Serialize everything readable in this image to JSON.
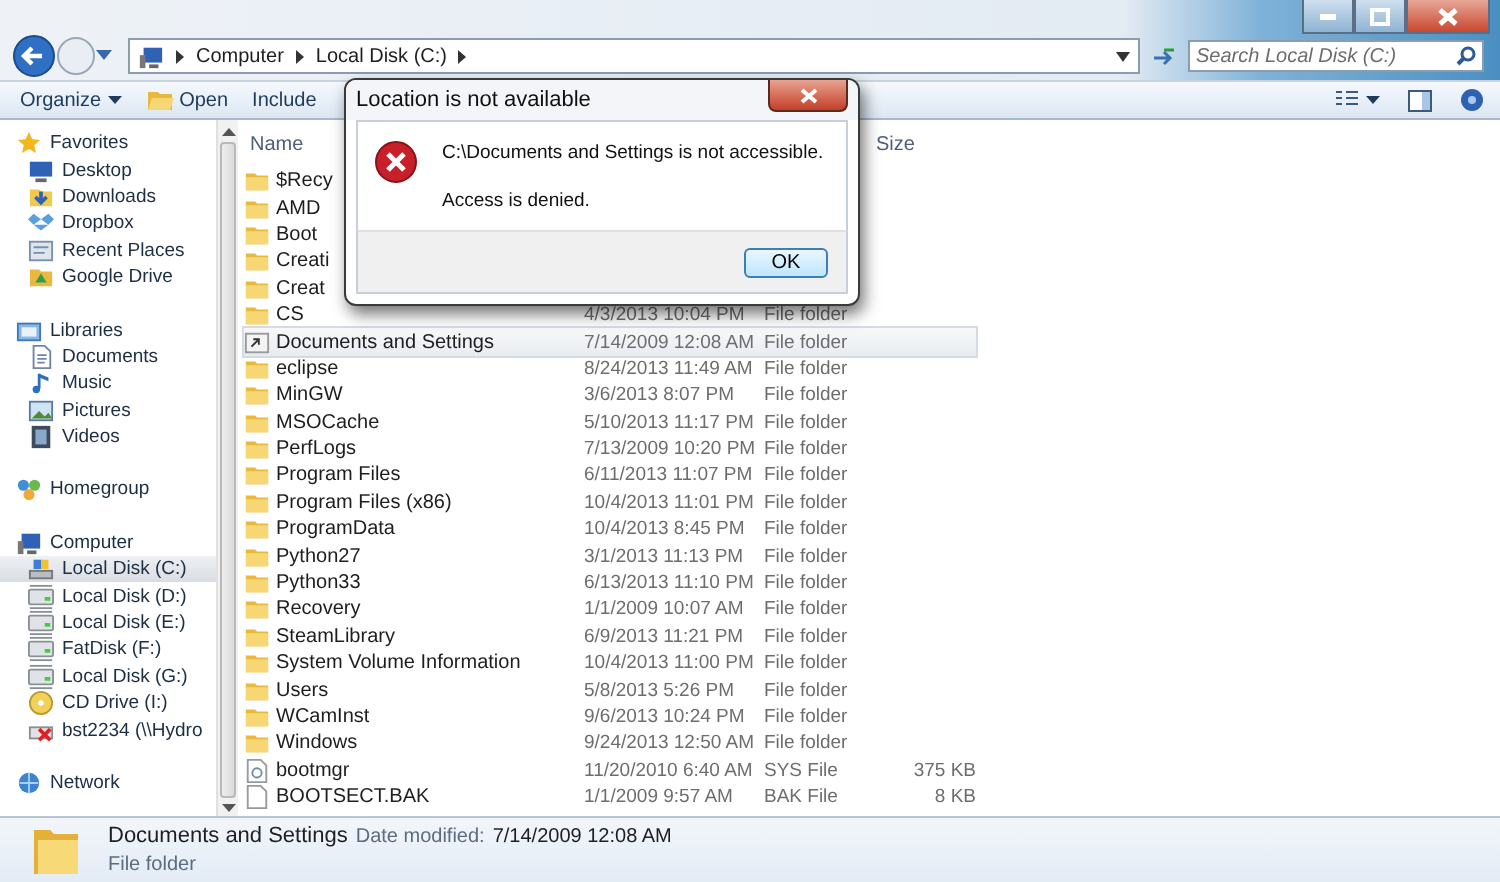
{
  "address": {
    "crumbs": [
      "Computer",
      "Local Disk (C:)"
    ]
  },
  "search": {
    "placeholder": "Search Local Disk (C:)"
  },
  "toolbar": {
    "items": [
      {
        "label": "Organize",
        "kind": "menu"
      },
      {
        "label": "Open",
        "kind": "open"
      },
      {
        "label": "Include",
        "kind": "plain"
      }
    ]
  },
  "nav": [
    {
      "label": "Favorites",
      "kind": "star",
      "selected": false,
      "children": [
        {
          "label": "Desktop",
          "kind": "desktop",
          "selected": false
        },
        {
          "label": "Downloads",
          "kind": "download",
          "selected": false
        },
        {
          "label": "Dropbox",
          "kind": "dropbox",
          "selected": false
        },
        {
          "label": "Recent Places",
          "kind": "recent",
          "selected": false
        },
        {
          "label": "Google Drive",
          "kind": "gdrive",
          "selected": false
        }
      ]
    },
    {
      "label": "Libraries",
      "kind": "library",
      "selected": false,
      "children": [
        {
          "label": "Documents",
          "kind": "document",
          "selected": false
        },
        {
          "label": "Music",
          "kind": "music",
          "selected": false
        },
        {
          "label": "Pictures",
          "kind": "picture",
          "selected": false
        },
        {
          "label": "Videos",
          "kind": "video",
          "selected": false
        }
      ]
    },
    {
      "label": "Homegroup",
      "kind": "homegroup",
      "selected": false
    },
    {
      "label": "Computer",
      "kind": "computer",
      "selected": false,
      "children": [
        {
          "label": "Local Disk (C:)",
          "kind": "sysdisk",
          "selected": true
        },
        {
          "label": "Local Disk (D:)",
          "kind": "disk",
          "selected": false
        },
        {
          "label": "Local Disk (E:)",
          "kind": "disk",
          "selected": false
        },
        {
          "label": "FatDisk (F:)",
          "kind": "disk",
          "selected": false
        },
        {
          "label": "Local Disk (G:)",
          "kind": "disk",
          "selected": false
        },
        {
          "label": "CD Drive (I:)",
          "kind": "cd",
          "selected": false
        },
        {
          "label": "bst2234 (\\\\Hydro",
          "kind": "netdrive",
          "selected": false
        }
      ]
    },
    {
      "label": "Network",
      "kind": "network",
      "selected": false
    }
  ],
  "table": {
    "columns": [
      "Name",
      "Size"
    ],
    "rows": [
      {
        "name": "$Recy",
        "kind": "folder",
        "selected": false
      },
      {
        "name": "AMD",
        "kind": "folder",
        "selected": false
      },
      {
        "name": "Boot",
        "kind": "folder",
        "selected": false
      },
      {
        "name": "Creati",
        "kind": "folder",
        "selected": false
      },
      {
        "name": "Creat",
        "kind": "folder",
        "selected": false
      },
      {
        "name": "CS",
        "date": "4/3/2013 10:04 PM",
        "type": "File folder",
        "kind": "folder",
        "selected": false
      },
      {
        "name": "Documents and Settings",
        "date": "7/14/2009 12:08 AM",
        "type": "File folder",
        "kind": "junction",
        "selected": true
      },
      {
        "name": "eclipse",
        "date": "8/24/2013 11:49 AM",
        "type": "File folder",
        "kind": "folder",
        "selected": false
      },
      {
        "name": "MinGW",
        "date": "3/6/2013 8:07 PM",
        "type": "File folder",
        "kind": "folder",
        "selected": false
      },
      {
        "name": "MSOCache",
        "date": "5/10/2013 11:17 PM",
        "type": "File folder",
        "kind": "folder",
        "selected": false
      },
      {
        "name": "PerfLogs",
        "date": "7/13/2009 10:20 PM",
        "type": "File folder",
        "kind": "folder",
        "selected": false
      },
      {
        "name": "Program Files",
        "date": "6/11/2013 11:07 PM",
        "type": "File folder",
        "kind": "folder",
        "selected": false
      },
      {
        "name": "Program Files (x86)",
        "date": "10/4/2013 11:01 PM",
        "type": "File folder",
        "kind": "folder",
        "selected": false
      },
      {
        "name": "ProgramData",
        "date": "10/4/2013 8:45 PM",
        "type": "File folder",
        "kind": "folder",
        "selected": false
      },
      {
        "name": "Python27",
        "date": "3/1/2013 11:13 PM",
        "type": "File folder",
        "kind": "folder",
        "selected": false
      },
      {
        "name": "Python33",
        "date": "6/13/2013 11:10 PM",
        "type": "File folder",
        "kind": "folder",
        "selected": false
      },
      {
        "name": "Recovery",
        "date": "1/1/2009 10:07 AM",
        "type": "File folder",
        "kind": "folder",
        "selected": false
      },
      {
        "name": "SteamLibrary",
        "date": "6/9/2013 11:21 PM",
        "type": "File folder",
        "kind": "folder",
        "selected": false
      },
      {
        "name": "System Volume Information",
        "date": "10/4/2013 11:00 PM",
        "type": "File folder",
        "kind": "folder",
        "selected": false
      },
      {
        "name": "Users",
        "date": "5/8/2013 5:26 PM",
        "type": "File folder",
        "kind": "folder",
        "selected": false
      },
      {
        "name": "WCamInst",
        "date": "9/6/2013 10:24 PM",
        "type": "File folder",
        "kind": "folder",
        "selected": false
      },
      {
        "name": "Windows",
        "date": "9/24/2013 12:50 AM",
        "type": "File folder",
        "kind": "folder",
        "selected": false
      },
      {
        "name": "bootmgr",
        "date": "11/20/2010 6:40 AM",
        "type": "SYS File",
        "size": "375 KB",
        "kind": "sysfile",
        "selected": false
      },
      {
        "name": "BOOTSECT.BAK",
        "date": "1/1/2009 9:57 AM",
        "type": "BAK File",
        "size": "8 KB",
        "kind": "file",
        "selected": false
      }
    ]
  },
  "details": {
    "name": "Documents and Settings",
    "label": "Date modified:",
    "value": "7/14/2009 12:08 AM",
    "type": "File folder"
  },
  "dialog": {
    "title": "Location is not available",
    "message": "C:\\Documents and Settings is not accessible.",
    "detail": "Access is denied.",
    "button": "OK"
  }
}
